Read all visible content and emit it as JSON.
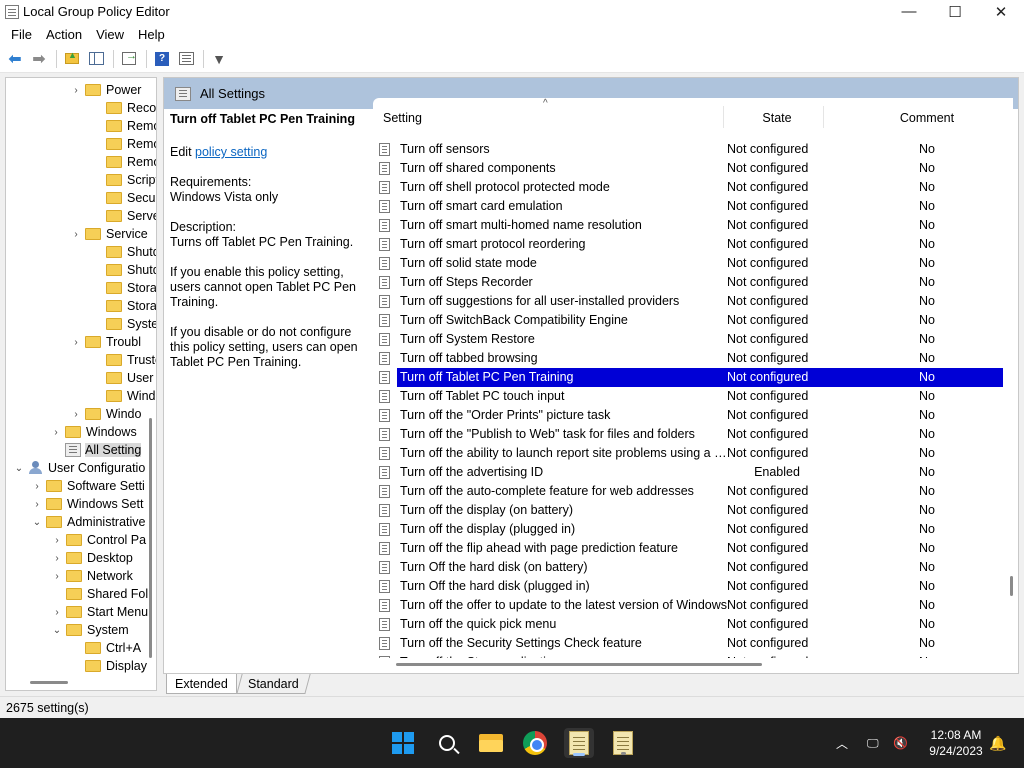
{
  "window": {
    "title": "Local Group Policy Editor",
    "controls": {
      "minimize": "—",
      "maximize": "☐",
      "close": "✕"
    }
  },
  "menu": [
    "File",
    "Action",
    "View",
    "Help"
  ],
  "toolbar": {
    "icons": [
      "back-arrow-icon",
      "forward-arrow-icon",
      "up-folder-icon",
      "show-hide-tree-icon",
      "export-list-icon",
      "help-icon",
      "properties-icon",
      "filter-icon"
    ]
  },
  "tree": {
    "rows": [
      {
        "label": "Power",
        "expander": "›",
        "icon": "folder"
      },
      {
        "label": "Recove",
        "expander": "",
        "icon": "folder"
      },
      {
        "label": "Remot",
        "expander": "",
        "icon": "folder"
      },
      {
        "label": "Remot",
        "expander": "",
        "icon": "folder"
      },
      {
        "label": "Remov",
        "expander": "",
        "icon": "folder"
      },
      {
        "label": "Scripts",
        "expander": "",
        "icon": "folder"
      },
      {
        "label": "Securit",
        "expander": "",
        "icon": "folder"
      },
      {
        "label": "Server",
        "expander": "",
        "icon": "folder"
      },
      {
        "label": "Service",
        "expander": "›",
        "icon": "folder"
      },
      {
        "label": "Shutdo",
        "expander": "",
        "icon": "folder"
      },
      {
        "label": "Shutdo",
        "expander": "",
        "icon": "folder"
      },
      {
        "label": "Storag",
        "expander": "",
        "icon": "folder"
      },
      {
        "label": "Storag",
        "expander": "",
        "icon": "folder"
      },
      {
        "label": "System",
        "expander": "",
        "icon": "folder"
      },
      {
        "label": "Troubl",
        "expander": "›",
        "icon": "folder"
      },
      {
        "label": "Truste",
        "expander": "",
        "icon": "folder"
      },
      {
        "label": "User Pr",
        "expander": "",
        "icon": "folder"
      },
      {
        "label": "Windo",
        "expander": "",
        "icon": "folder"
      },
      {
        "label": "Windo",
        "expander": "›",
        "icon": "folder"
      },
      {
        "label": "Windows",
        "expander": "›",
        "icon": "folder"
      },
      {
        "label": "All Setting",
        "expander": "",
        "icon": "settings",
        "selected": true
      },
      {
        "label": "User Configuratio",
        "expander": "⌄",
        "icon": "user"
      },
      {
        "label": "Software Setti",
        "expander": "›",
        "icon": "folder"
      },
      {
        "label": "Windows Sett",
        "expander": "›",
        "icon": "folder"
      },
      {
        "label": "Administrative",
        "expander": "⌄",
        "icon": "folder"
      },
      {
        "label": "Control Pa",
        "expander": "›",
        "icon": "folder"
      },
      {
        "label": "Desktop",
        "expander": "›",
        "icon": "folder"
      },
      {
        "label": "Network",
        "expander": "›",
        "icon": "folder"
      },
      {
        "label": "Shared Fol",
        "expander": "",
        "icon": "folder"
      },
      {
        "label": "Start Menu",
        "expander": "›",
        "icon": "folder"
      },
      {
        "label": "System",
        "expander": "⌄",
        "icon": "folder"
      },
      {
        "label": "Ctrl+A",
        "expander": "",
        "icon": "folder"
      },
      {
        "label": "Display",
        "expander": "",
        "icon": "folder"
      }
    ]
  },
  "content": {
    "header_title": "All Settings",
    "description": {
      "title": "Turn off Tablet PC Pen Training",
      "edit_prefix": "Edit ",
      "edit_link": "policy setting ",
      "requirements_label": "Requirements:",
      "requirements_value": "Windows Vista only",
      "description_label": "Description:",
      "description_text": "Turns off Tablet PC Pen Training.",
      "enable_text": "If you enable this policy setting, users cannot open Tablet PC Pen Training.",
      "disable_text": "If you disable or do not configure this policy setting, users can open Tablet PC Pen Training."
    },
    "columns": {
      "setting": "Setting",
      "state": "State",
      "comment": "Comment"
    },
    "sort_indicator": "^",
    "rows": [
      {
        "name": "Turn off sensors",
        "state": "Not configured",
        "comment": "No"
      },
      {
        "name": "Turn off shared components",
        "state": "Not configured",
        "comment": "No"
      },
      {
        "name": "Turn off shell protocol protected mode",
        "state": "Not configured",
        "comment": "No"
      },
      {
        "name": "Turn off smart card emulation",
        "state": "Not configured",
        "comment": "No"
      },
      {
        "name": "Turn off smart multi-homed name resolution",
        "state": "Not configured",
        "comment": "No"
      },
      {
        "name": "Turn off smart protocol reordering",
        "state": "Not configured",
        "comment": "No"
      },
      {
        "name": "Turn off solid state mode",
        "state": "Not configured",
        "comment": "No"
      },
      {
        "name": "Turn off Steps Recorder",
        "state": "Not configured",
        "comment": "No"
      },
      {
        "name": "Turn off suggestions for all user-installed providers",
        "state": "Not configured",
        "comment": "No"
      },
      {
        "name": "Turn off SwitchBack Compatibility Engine",
        "state": "Not configured",
        "comment": "No"
      },
      {
        "name": "Turn off System Restore",
        "state": "Not configured",
        "comment": "No"
      },
      {
        "name": "Turn off tabbed browsing",
        "state": "Not configured",
        "comment": "No"
      },
      {
        "name": "Turn off Tablet PC Pen Training",
        "state": "Not configured",
        "comment": "No",
        "selected": true
      },
      {
        "name": "Turn off Tablet PC touch input",
        "state": "Not configured",
        "comment": "No"
      },
      {
        "name": "Turn off the \"Order Prints\" picture task",
        "state": "Not configured",
        "comment": "No"
      },
      {
        "name": "Turn off the \"Publish to Web\" task for files and folders",
        "state": "Not configured",
        "comment": "No"
      },
      {
        "name": "Turn off the ability to launch report site problems using a m...",
        "state": "Not configured",
        "comment": "No"
      },
      {
        "name": "Turn off the advertising ID",
        "state": "Enabled",
        "comment": "No"
      },
      {
        "name": "Turn off the auto-complete feature for web addresses",
        "state": "Not configured",
        "comment": "No"
      },
      {
        "name": "Turn off the display (on battery)",
        "state": "Not configured",
        "comment": "No"
      },
      {
        "name": "Turn off the display (plugged in)",
        "state": "Not configured",
        "comment": "No"
      },
      {
        "name": "Turn off the flip ahead with page prediction feature",
        "state": "Not configured",
        "comment": "No"
      },
      {
        "name": "Turn Off the hard disk (on battery)",
        "state": "Not configured",
        "comment": "No"
      },
      {
        "name": "Turn Off the hard disk (plugged in)",
        "state": "Not configured",
        "comment": "No"
      },
      {
        "name": "Turn off the offer to update to the latest version of Windows",
        "state": "Not configured",
        "comment": "No"
      },
      {
        "name": "Turn off the quick pick menu",
        "state": "Not configured",
        "comment": "No"
      },
      {
        "name": "Turn off the Security Settings Check feature",
        "state": "Not configured",
        "comment": "No"
      },
      {
        "name": "Turn off the Store application",
        "state": "Not configured",
        "comment": "No"
      }
    ]
  },
  "tabs": [
    "Extended",
    "Standard"
  ],
  "status": "2675 setting(s)",
  "taskbar": {
    "clock_time": "12:08 AM",
    "clock_date": "9/24/2023",
    "accent": "#1e9bf0"
  }
}
